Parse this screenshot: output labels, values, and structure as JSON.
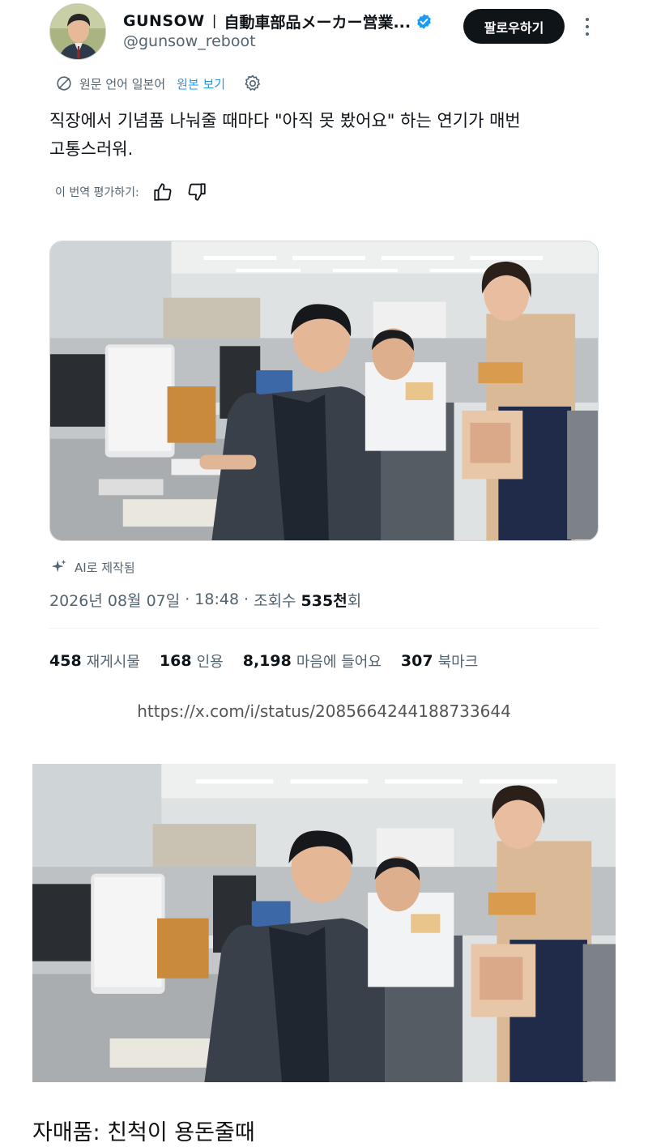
{
  "header": {
    "display_name": "GUNSOW",
    "separator": "|",
    "bio_snippet": "自動車部品メーカー営業...",
    "handle": "@gunsow_reboot",
    "follow_label": "팔로우하기",
    "verified_color": "#1d9bf0"
  },
  "translation": {
    "source_label": "원문 언어 일본어",
    "show_original": "원본 보기"
  },
  "tweet": {
    "text_line1": "직장에서 기념품 나눠줄 때마다 \"아직 못 봤어요\" 하는 연기가 매번",
    "text_line2": "고통스러워."
  },
  "rating": {
    "label": "이 번역 평가하기:"
  },
  "media": {
    "ai_label": "AI로 제작됨"
  },
  "meta": {
    "date": "2026년 08월 07일",
    "time": "18:48",
    "views_label": "조회수",
    "views_num": "535천",
    "views_suffix": "회"
  },
  "stats": [
    {
      "num": "458",
      "label": "재게시물"
    },
    {
      "num": "168",
      "label": "인용"
    },
    {
      "num": "8,198",
      "label": "마음에 들어요"
    },
    {
      "num": "307",
      "label": "북마크"
    }
  ],
  "url": "https://x.com/i/status/2085664244188733644",
  "caption": "자매품: 친척이 용돈줄때",
  "colors": {
    "accent": "#1d9bf0",
    "text": "#0f1419",
    "secondary": "#536471"
  }
}
